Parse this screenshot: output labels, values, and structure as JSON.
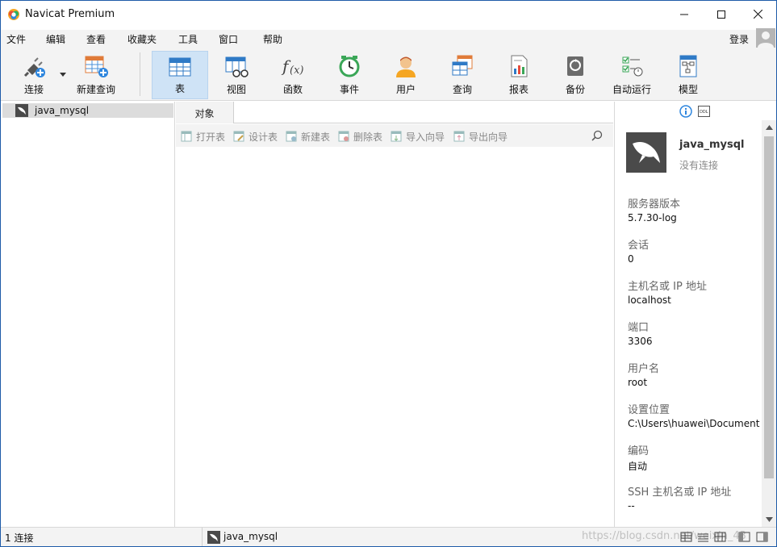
{
  "window": {
    "title": "Navicat Premium"
  },
  "menu": {
    "items": [
      "文件",
      "编辑",
      "查看",
      "收藏夹",
      "工具",
      "窗口",
      "帮助"
    ],
    "login": "登录"
  },
  "toolbar": {
    "connect": "连接",
    "new_query": "新建查询",
    "tools": [
      "表",
      "视图",
      "函数",
      "事件",
      "用户",
      "查询",
      "报表",
      "备份",
      "自动运行",
      "模型"
    ],
    "active": "表"
  },
  "tree": {
    "connection": "java_mysql"
  },
  "objects": {
    "tab": "对象",
    "actions": [
      "打开表",
      "设计表",
      "新建表",
      "删除表",
      "导入向导",
      "导出向导"
    ]
  },
  "info": {
    "name": "java_mysql",
    "status": "没有连接",
    "properties": [
      {
        "label": "服务器版本",
        "value": "5.7.30-log"
      },
      {
        "label": "会话",
        "value": "0"
      },
      {
        "label": "主机名或 IP 地址",
        "value": "localhost"
      },
      {
        "label": "端口",
        "value": "3306"
      },
      {
        "label": "用户名",
        "value": "root"
      },
      {
        "label": "设置位置",
        "value": "C:\\Users\\huawei\\Document"
      },
      {
        "label": "编码",
        "value": "自动"
      },
      {
        "label": "SSH 主机名或 IP 地址",
        "value": "--"
      }
    ]
  },
  "status": {
    "left": "1 连接",
    "connection": "java_mysql",
    "watermark": "https://blog.csdn.net/weixin_43"
  },
  "colors": {
    "accent": "#1e5ba8",
    "active_tool": "#cfe3f6",
    "mysql_logo": "#4a4a4a"
  }
}
